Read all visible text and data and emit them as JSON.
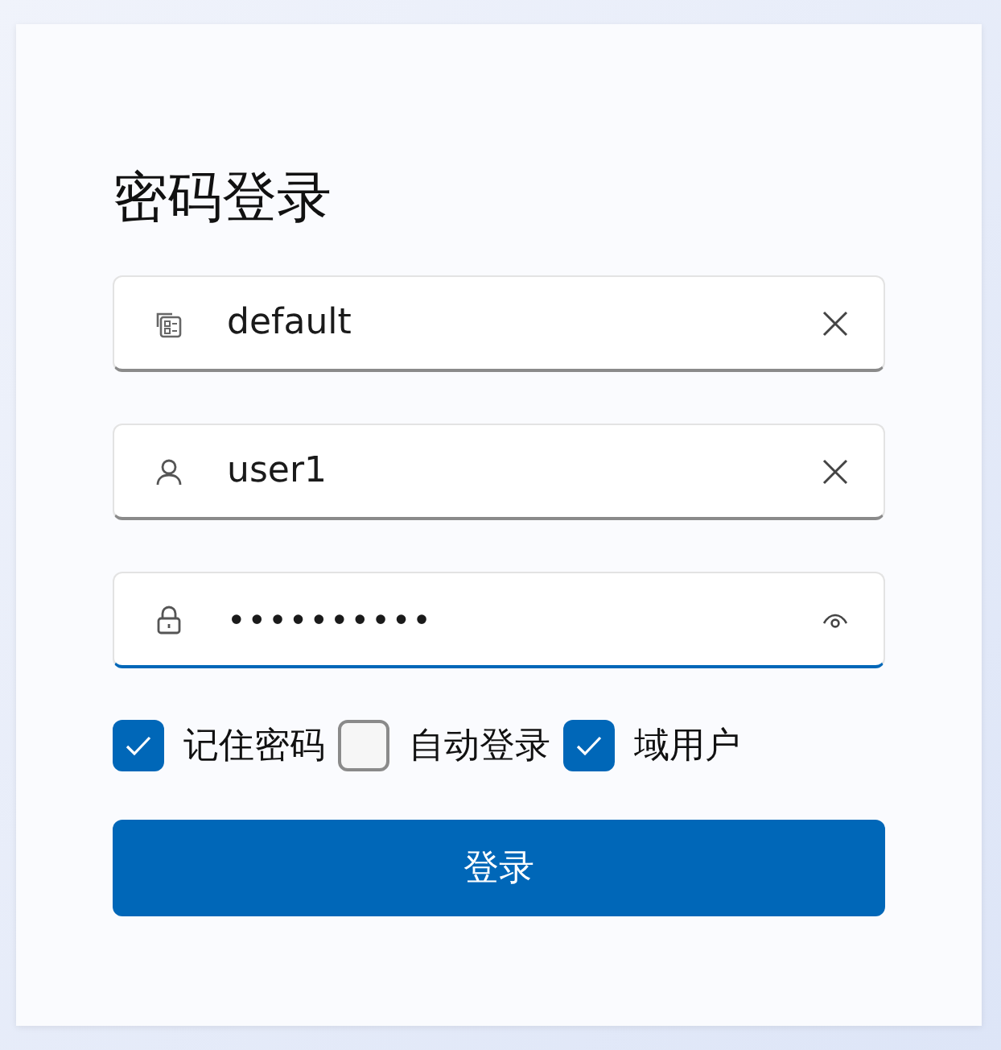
{
  "title": "密码登录",
  "fields": [
    {
      "kind": "domain",
      "value": "default",
      "focused": false
    },
    {
      "kind": "user",
      "value": "user1",
      "focused": false
    },
    {
      "kind": "password",
      "value": "••••••••••",
      "focused": true
    }
  ],
  "options": [
    {
      "label": "记住密码",
      "checked": true
    },
    {
      "label": "自动登录",
      "checked": false
    },
    {
      "label": "域用户",
      "checked": true
    }
  ],
  "button": "登录"
}
